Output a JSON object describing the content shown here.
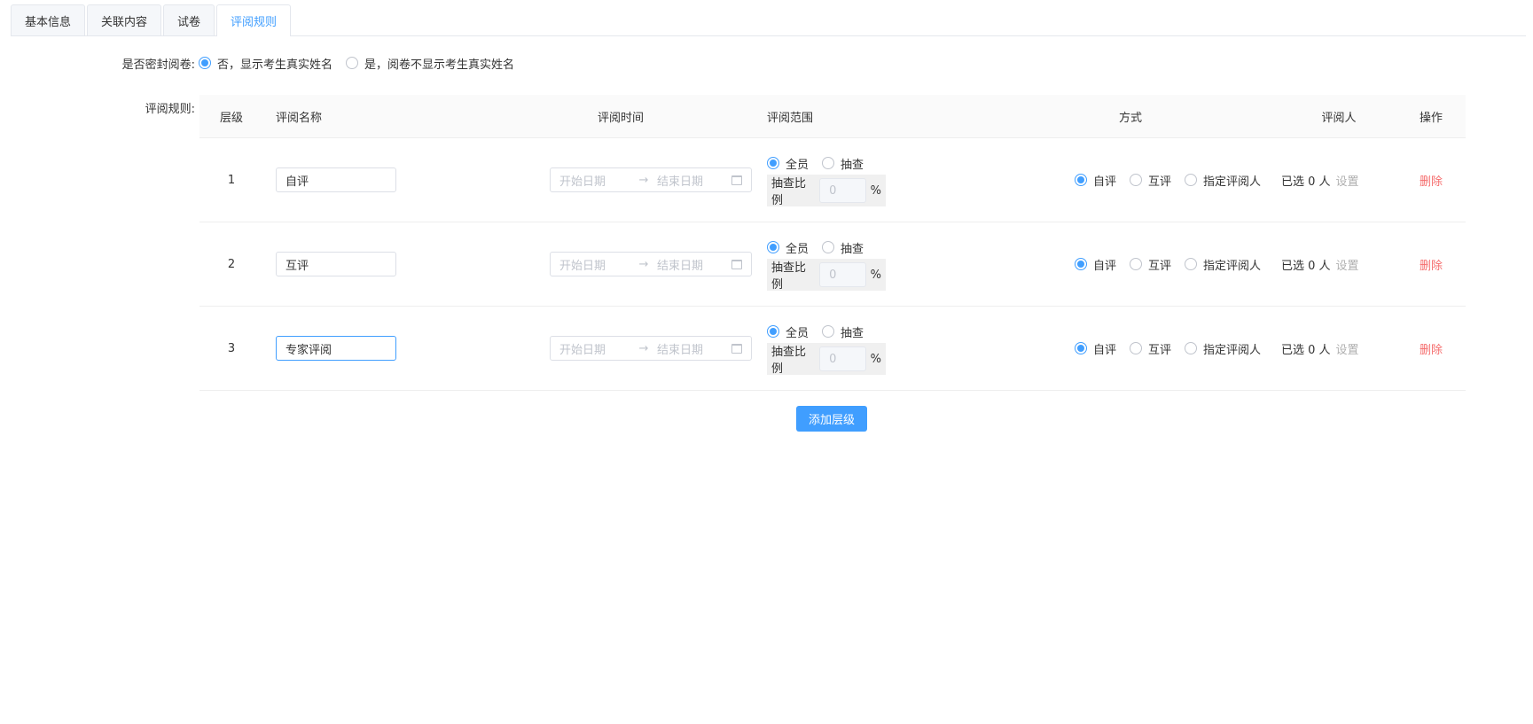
{
  "tabs": [
    {
      "label": "基本信息",
      "active": false
    },
    {
      "label": "关联内容",
      "active": false
    },
    {
      "label": "试卷",
      "active": false
    },
    {
      "label": "评阅规则",
      "active": true
    }
  ],
  "blind_review": {
    "label": "是否密封阅卷:",
    "options": [
      {
        "label": "否，显示考生真实姓名",
        "checked": true
      },
      {
        "label": "是，阅卷不显示考生真实姓名",
        "checked": false
      }
    ]
  },
  "rules": {
    "label": "评阅规则:",
    "headers": {
      "level": "层级",
      "name": "评阅名称",
      "time": "评阅时间",
      "range": "评阅范围",
      "mode": "方式",
      "reviewer": "评阅人",
      "op": "操作"
    },
    "date_start_placeholder": "开始日期",
    "date_separator": "→",
    "date_end_placeholder": "结束日期",
    "range_all": "全员",
    "range_sample": "抽查",
    "ratio_label": "抽查比例",
    "ratio_placeholder": "0",
    "ratio_unit": "%",
    "mode_self": "自评",
    "mode_peer": "互评",
    "mode_assigned": "指定评阅人",
    "reviewer_selected": "已选 0 人",
    "reviewer_set": "设置",
    "delete": "删除",
    "rows": [
      {
        "level": "1",
        "name": "自评"
      },
      {
        "level": "2",
        "name": "互评"
      },
      {
        "level": "3",
        "name": "专家评阅"
      }
    ]
  },
  "add_button": "添加层级",
  "colors": {
    "accent": "#409eff",
    "danger": "#f56c6c"
  }
}
